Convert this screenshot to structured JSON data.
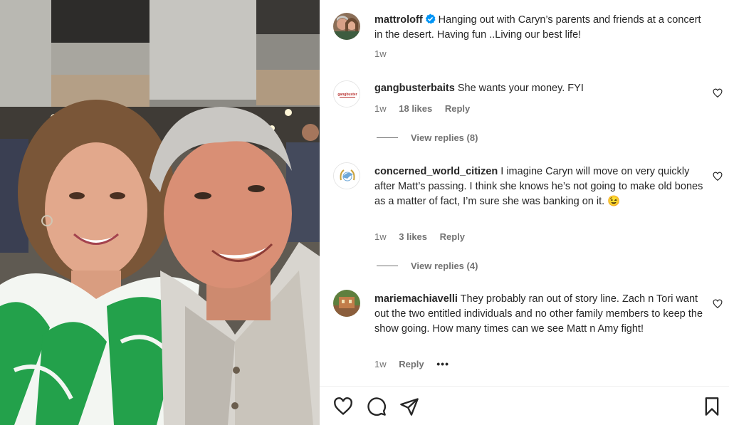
{
  "post": {
    "author": "mattroloff",
    "caption": "Hanging out with Caryn’s parents and friends at a concert in the desert. Having fun ..Living our best life!",
    "time": "1w"
  },
  "comments": [
    {
      "username": "gangbusterbaits",
      "text": "She wants your money. FYI",
      "time": "1w",
      "likes": "18 likes",
      "reply": "Reply",
      "view_replies": "View replies (8)"
    },
    {
      "username": "concerned_world_citizen",
      "text": "I imagine Caryn will move on very quickly after Matt’s passing. I think she knows he’s not going to make old bones as a matter of fact, I’m sure she was banking on it. 😉",
      "time": "1w",
      "likes": "3 likes",
      "reply": "Reply",
      "view_replies": "View replies (4)"
    },
    {
      "username": "mariemachiavelli",
      "text": "They probably ran out of story line. Zach n Tori want out the two entitled individuals and no other family members to keep the show going. How many times can we see Matt n Amy fight!",
      "time": "1w",
      "reply": "Reply",
      "more": "•••"
    }
  ],
  "icons": {
    "verified": "verified-badge-icon",
    "heart": "heart-icon",
    "comment": "comment-bubble-icon",
    "share": "paper-plane-icon",
    "save": "bookmark-icon"
  },
  "colors": {
    "text": "#262626",
    "secondary": "#737373",
    "verified_blue": "#0095f6",
    "divider": "#efefef"
  }
}
